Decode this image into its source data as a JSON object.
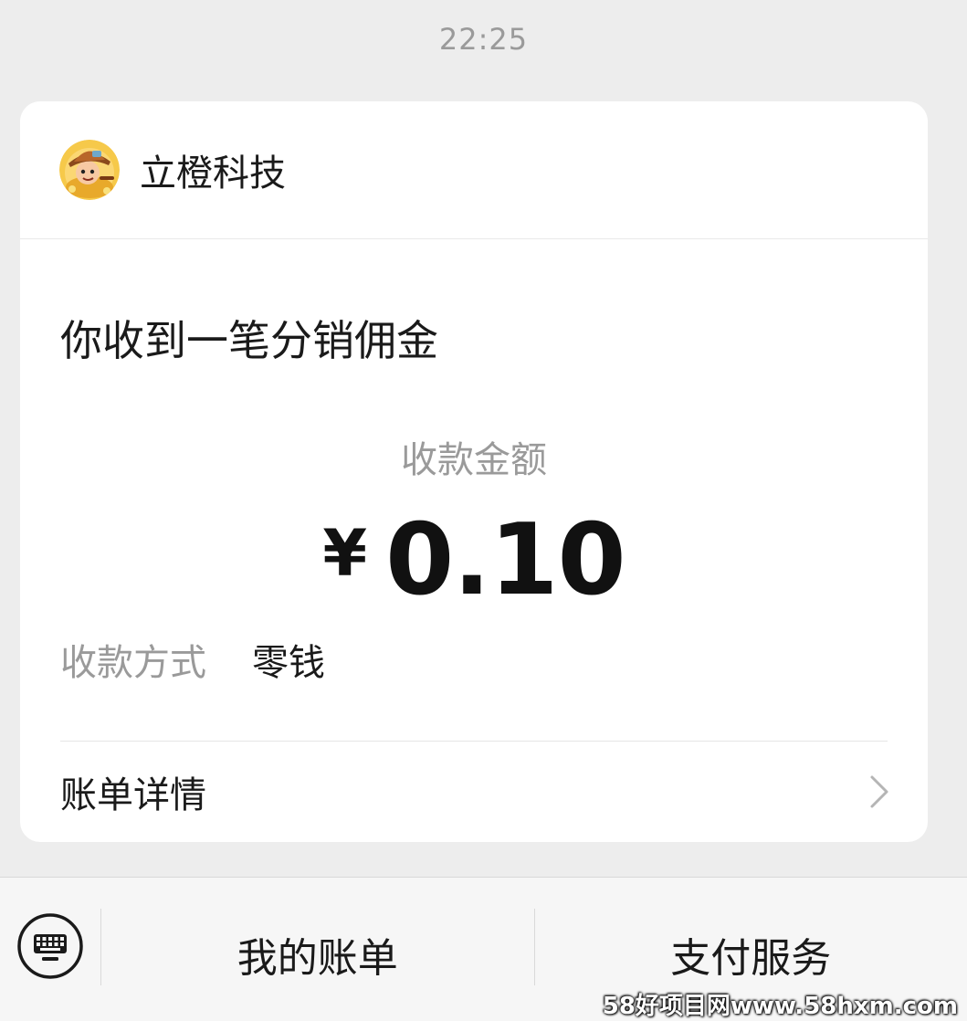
{
  "status": {
    "time": "22:25"
  },
  "card": {
    "sender": {
      "name": "立橙科技",
      "avatar_icon": "cartoon-explorer-avatar"
    },
    "notice_title": "你收到一笔分销佣金",
    "amount_label": "收款金额",
    "currency_symbol": "¥",
    "amount_value": "0.10",
    "method_label": "收款方式",
    "method_value": "零钱",
    "detail_label": "账单详情"
  },
  "bottom_bar": {
    "keyboard_icon": "keyboard-icon",
    "menu_items": [
      {
        "label": "我的账单"
      },
      {
        "label": "支付服务"
      }
    ]
  },
  "watermark": "58好项目网www.58hxm.com",
  "colors": {
    "background": "#ededed",
    "card": "#ffffff",
    "primary_text": "#1a1a1a",
    "secondary_text": "#9a9a9a",
    "bottom_bar": "#f6f6f6"
  }
}
